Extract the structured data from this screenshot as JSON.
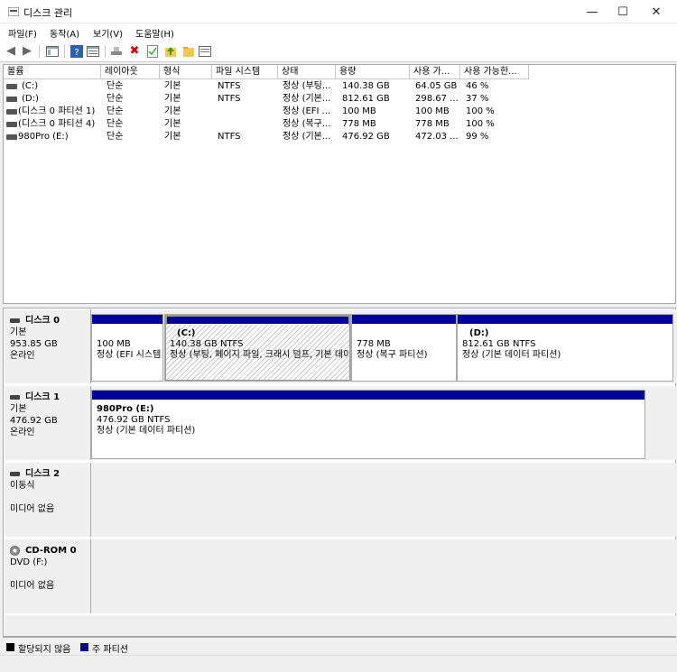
{
  "window": {
    "title": "디스크 관리",
    "minimize": "—",
    "maximize": "☐",
    "close": "✕"
  },
  "menu": [
    "파일(F)",
    "동작(A)",
    "보기(V)",
    "도움말(H)"
  ],
  "toolbar": {
    "icons": [
      "back-arrow-icon",
      "forward-arrow-icon",
      "console-tree-icon",
      "help-icon",
      "properties-icon",
      "connect-icon",
      "delete-icon",
      "check-icon",
      "up-folder-icon",
      "open-folder-icon",
      "view-icon"
    ],
    "delete_color": "#d40000"
  },
  "volume_list": {
    "columns": [
      "볼륨",
      "레이아웃",
      "형식",
      "파일 시스템",
      "상태",
      "용량",
      "사용 가...",
      "사용 가능한..."
    ],
    "rows": [
      [
        "(C:)",
        "단순",
        "기본",
        "NTFS",
        "정상 (부팅...",
        "140.38 GB",
        "64.05 GB",
        "46 %"
      ],
      [
        "(D:)",
        "단순",
        "기본",
        "NTFS",
        "정상 (기본...",
        "812.61 GB",
        "298.67 ...",
        "37 %"
      ],
      [
        "(디스크 0 파티션 1)",
        "단순",
        "기본",
        "",
        "정상 (EFI ...",
        "100 MB",
        "100 MB",
        "100 %"
      ],
      [
        "(디스크 0 파티션 4)",
        "단순",
        "기본",
        "",
        "정상 (복구...",
        "778 MB",
        "778 MB",
        "100 %"
      ],
      [
        "980Pro (E:)",
        "단순",
        "기본",
        "NTFS",
        "정상 (기본...",
        "476.92 GB",
        "472.03 ...",
        "99 %"
      ]
    ]
  },
  "disks": [
    {
      "name": "디스크 0",
      "type": "기본",
      "size": "953.85 GB",
      "status": "온라인",
      "partitions": [
        {
          "title": "",
          "size": "100 MB",
          "status": "정상 (EFI 시스템 파티션)"
        },
        {
          "title": "(C:)",
          "size": "140.38 GB NTFS",
          "status": "정상 (부팅, 페이지 파일, 크래시 덤프, 기본 데이터 파티션)"
        },
        {
          "title": "",
          "size": "778 MB",
          "status": "정상 (복구 파티션)"
        },
        {
          "title": "(D:)",
          "size": "812.61 GB NTFS",
          "status": "정상 (기본 데이터 파티션)"
        }
      ]
    },
    {
      "name": "디스크 1",
      "type": "기본",
      "size": "476.92 GB",
      "status": "온라인",
      "partitions": [
        {
          "title": "980Pro  (E:)",
          "size": "476.92 GB NTFS",
          "status": "정상 (기본 데이터 파티션)"
        }
      ]
    },
    {
      "name": "디스크 2",
      "type": "이동식",
      "size": "",
      "status": "미디어 없음"
    },
    {
      "name": "CD-ROM 0",
      "type": "DVD (F:)",
      "size": "",
      "status": "미디어 없음"
    }
  ],
  "legend": [
    {
      "label": "할당되지 않음",
      "color": "#000000"
    },
    {
      "label": "주 파티션",
      "color": "#000099"
    }
  ]
}
